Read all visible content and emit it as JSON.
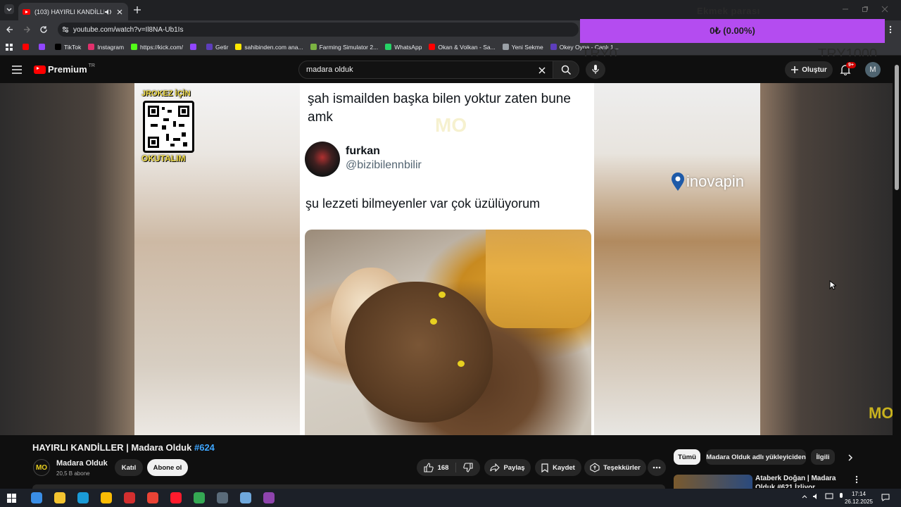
{
  "browser": {
    "tab_title": "(103) HAYIRLI KANDİLLER |",
    "url": "youtube.com/watch?v=Il8NA-Ub1Is",
    "bookmarks": [
      {
        "label": "",
        "color": "#ff0000"
      },
      {
        "label": "",
        "color": "#9146ff"
      },
      {
        "label": "TikTok",
        "color": "#000000"
      },
      {
        "label": "Instagram",
        "color": "#e1306c"
      },
      {
        "label": "https://kick.com/",
        "color": "#53fc18"
      },
      {
        "label": "",
        "color": "#9146ff"
      },
      {
        "label": "Getir",
        "color": "#5d3ebc"
      },
      {
        "label": "sahibinden.com ana...",
        "color": "#ffe800"
      },
      {
        "label": "Farming Simulator 2...",
        "color": "#7cb342"
      },
      {
        "label": "WhatsApp",
        "color": "#25d366"
      },
      {
        "label": "Okan & Volkan - Sa...",
        "color": "#ff0000"
      },
      {
        "label": "Yeni Sekme",
        "color": "#9aa0a6"
      },
      {
        "label": "Okey Oyna - Canlı 1...",
        "color": "#5d3ebc"
      }
    ]
  },
  "overlay": {
    "donate_title": "Ekmek parası",
    "donate_value": "0₺ (0.00%)",
    "goal_min": "TRY0",
    "goal_max": "TRY1000",
    "progress_fraction": 0.0
  },
  "masthead": {
    "logo_text": "Premium",
    "logo_region": "TR",
    "search_value": "madara olduk",
    "create_label": "Oluştur",
    "notif_badge": "9+",
    "avatar_letter": "M"
  },
  "video": {
    "tweet_header": "şah ismailden başka bilen yoktur zaten bune amk",
    "tweet_name": "furkan",
    "tweet_handle": "@bizibilennbilir",
    "tweet_body": "şu lezzeti bilmeyenler var çok üzülüyorum",
    "qr_top": "JROKEZ İÇİN",
    "qr_bottom": "OKUTALIM",
    "sponsor": "inovapin",
    "watermark": "MO"
  },
  "meta": {
    "title": "HAYIRLI KANDİLLER | Madara Olduk",
    "title_tag": "#624",
    "channel_name": "Madara Olduk",
    "channel_subs": "20,5 B abone",
    "join_label": "Katıl",
    "subscribe_label": "Abone ol",
    "likes": "168",
    "share_label": "Paylaş",
    "save_label": "Kaydet",
    "thanks_label": "Teşekkürler"
  },
  "sidebar": {
    "chips": [
      "Tümü",
      "Madara Olduk adlı yükleyiciden",
      "İlgili"
    ],
    "rec_title": "Ataberk Doğan | Madara Olduk #621 İzliyor"
  },
  "taskbar": {
    "time": "17:14",
    "date": "26.12.2025",
    "icon_colors": [
      "#3a8ee6",
      "#f4c430",
      "#1a9bd7",
      "#fbbc05",
      "#d32f2f",
      "#ea4335",
      "#ff1b2d",
      "#34a853",
      "#5a6b7a",
      "#6fa8dc",
      "#8e44ad"
    ]
  }
}
